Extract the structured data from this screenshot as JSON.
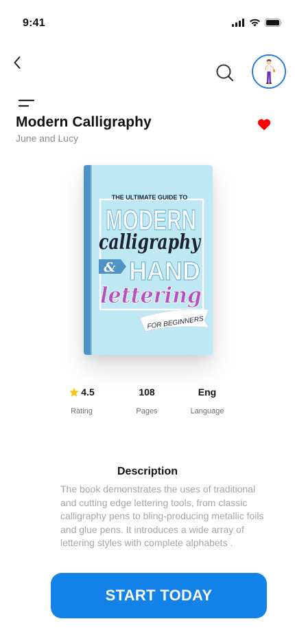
{
  "status_bar": {
    "time": "9:41",
    "icons": [
      "cellular-signal-icon",
      "wifi-icon",
      "battery-icon"
    ]
  },
  "nav": {
    "back_icon": "chevron-left-icon",
    "search_icon": "search-icon",
    "menu_icon": "menu-icon"
  },
  "book": {
    "title": "Modern Calligraphy",
    "author": "June and Lucy",
    "favorited": true,
    "favorite_color": "#ff0000",
    "cover": {
      "line1": "THE ULTIMATE GUIDE TO",
      "line2": "MODERN",
      "line3": "calligraphy",
      "line4_amp": "&",
      "line4": "HAND",
      "line5": "lettering",
      "ribbon": "FOR BEGINNERS",
      "background_color": "#bfe8f5",
      "spine_color": "#4f93c6"
    }
  },
  "stats": {
    "rating": {
      "value": "4.5",
      "label": "Rating",
      "icon": "star-icon"
    },
    "pages": {
      "value": "108",
      "label": "Pages"
    },
    "language": {
      "value": "Eng",
      "label": "Language"
    }
  },
  "description": {
    "heading": "Description",
    "text": "The book demonstrates the uses of traditional and cutting edge lettering tools, from classic calligraphy pens to bling-producing metallic foils and glue pens. It introduces a wide array of lettering styles with complete alphabets ."
  },
  "cta": {
    "label": "START TODAY",
    "color": "#1282e8"
  }
}
